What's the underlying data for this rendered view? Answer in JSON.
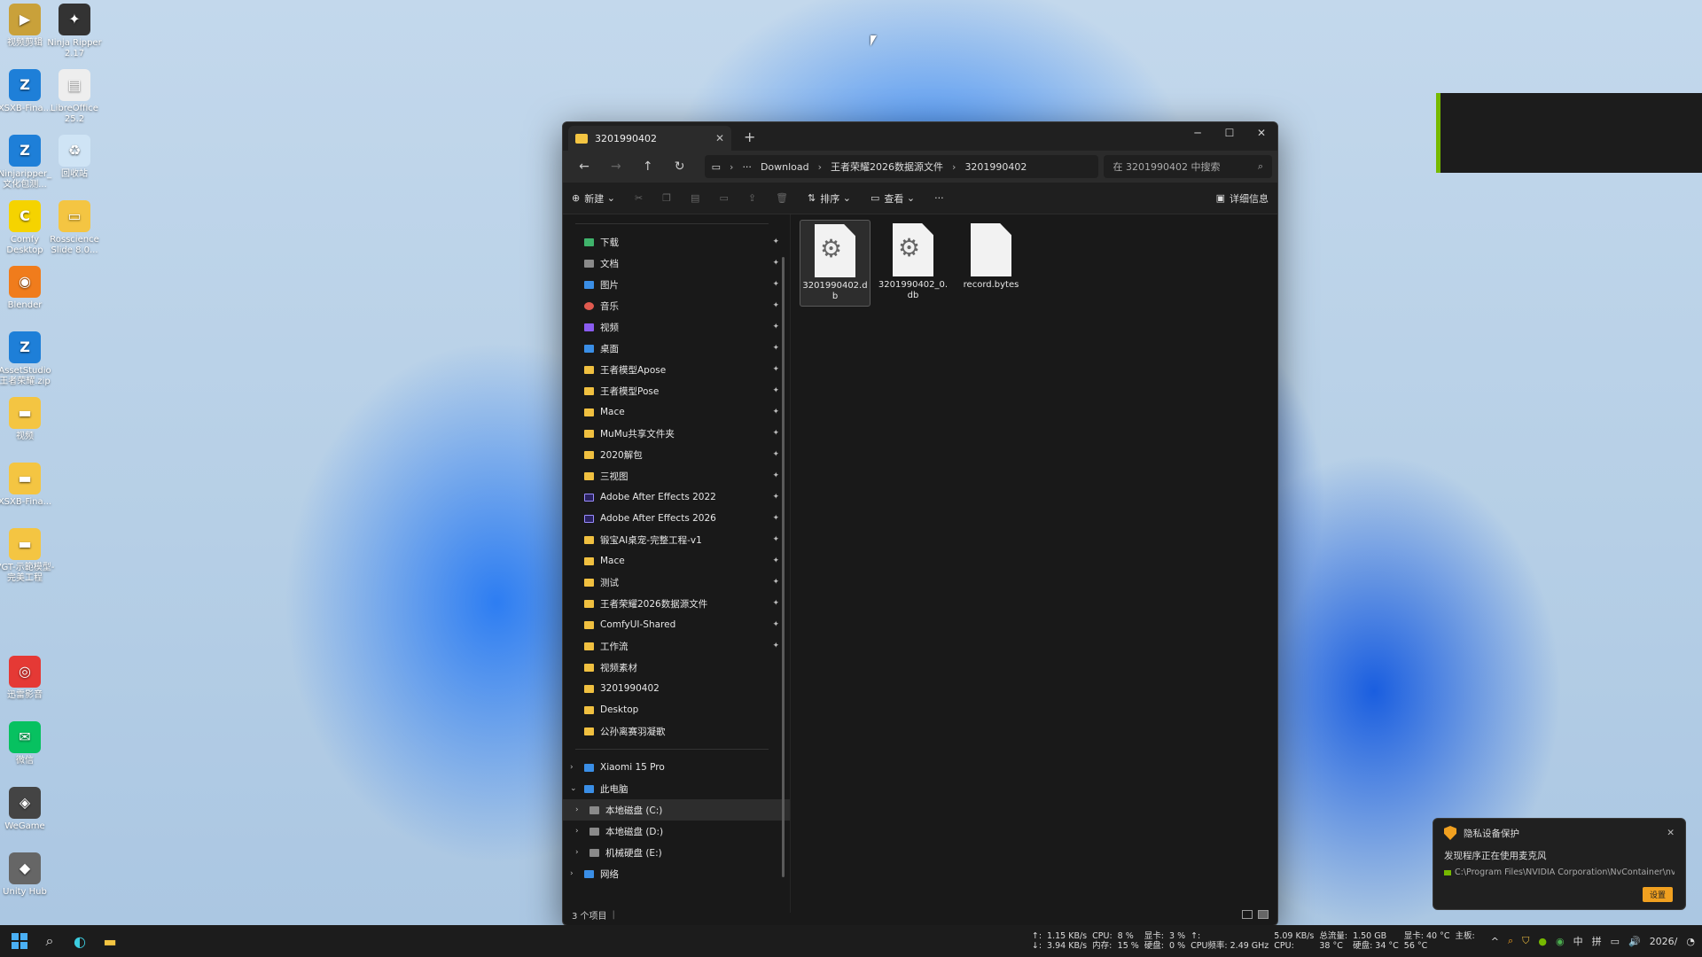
{
  "desktop": {
    "icons": [
      {
        "label": "视频剪辑",
        "glyph": "▶",
        "color": "#c9a13a"
      },
      {
        "label": "Ninja Ripper 2.17",
        "glyph": "✦",
        "color": "#333333"
      },
      {
        "label": "XSXB-Fina...",
        "glyph": "Z",
        "color": "#1e7fd8"
      },
      {
        "label": "LibreOffice 25.2",
        "glyph": "▤",
        "color": "#eeeeee"
      },
      {
        "label": "Ninjaripper_文化包测...",
        "glyph": "Z",
        "color": "#1e7fd8"
      },
      {
        "label": "回收站",
        "glyph": "♻",
        "color": "#cfe4f5"
      },
      {
        "label": "Comfy Desktop",
        "glyph": "C",
        "color": "#f5d300"
      },
      {
        "label": "Rosscience Slide 8.0...",
        "glyph": "▭",
        "color": "#f4c542"
      },
      {
        "label": "Blender",
        "glyph": "◉",
        "color": "#f07c1c"
      },
      {
        "label": "AssetStudio 王者荣耀.zip",
        "glyph": "Z",
        "color": "#1e7fd8"
      },
      {
        "label": "视频",
        "glyph": "▬",
        "color": "#f4c542"
      },
      {
        "label": "XSXB-Fina...",
        "glyph": "▬",
        "color": "#f4c542"
      },
      {
        "label": "VGT-示範模型-完美工程",
        "glyph": "▬",
        "color": "#f4c542"
      },
      {
        "label": "迅雷影音",
        "glyph": "◎",
        "color": "#e53935"
      },
      {
        "label": "微信",
        "glyph": "✉",
        "color": "#07c160"
      },
      {
        "label": "WeGame",
        "glyph": "◈",
        "color": "#444444"
      },
      {
        "label": "Unity Hub",
        "glyph": "◆",
        "color": "#666666"
      }
    ]
  },
  "explorer": {
    "tab_title": "3201990402",
    "tab_close": "✕",
    "new_tab": "+",
    "window_controls": {
      "minimize": "─",
      "maximize": "☐",
      "close": "✕"
    },
    "nav": {
      "back": "←",
      "forward": "→",
      "up": "↑",
      "refresh": "↻",
      "pc": "🖵",
      "more": "···"
    },
    "breadcrumb": [
      "Download",
      "王者荣耀2026数据源文件",
      "3201990402"
    ],
    "search_placeholder": "在 3201990402 中搜索",
    "toolbar": {
      "new": "新建",
      "sort": "排序",
      "view": "查看",
      "more": "···",
      "details": "详细信息"
    },
    "quick_access": [
      {
        "label": "下载",
        "color": "green"
      },
      {
        "label": "文档",
        "color": "gray"
      },
      {
        "label": "图片",
        "color": "blue"
      },
      {
        "label": "音乐",
        "color": "red"
      },
      {
        "label": "视频",
        "color": "purple"
      },
      {
        "label": "桌面",
        "color": "blue"
      },
      {
        "label": "王者模型Apose",
        "color": "folder"
      },
      {
        "label": "王者模型Pose",
        "color": "folder"
      },
      {
        "label": "Mace",
        "color": "folder"
      },
      {
        "label": "MuMu共享文件夹",
        "color": "folder"
      },
      {
        "label": "2020解包",
        "color": "folder"
      },
      {
        "label": "三视图",
        "color": "folder"
      },
      {
        "label": "Adobe After Effects 2022",
        "color": "ae"
      },
      {
        "label": "Adobe After Effects 2026",
        "color": "ae"
      },
      {
        "label": "锻宝AI桌宠-完整工程-v1",
        "color": "folder"
      },
      {
        "label": "Mace",
        "color": "folder"
      },
      {
        "label": "测试",
        "color": "folder"
      },
      {
        "label": "王者荣耀2026数据源文件",
        "color": "folder"
      },
      {
        "label": "ComfyUI-Shared",
        "color": "folder"
      },
      {
        "label": "工作流",
        "color": "folder"
      },
      {
        "label": "视频素材",
        "color": "folder"
      },
      {
        "label": "3201990402",
        "color": "folder"
      },
      {
        "label": "Desktop",
        "color": "folder"
      },
      {
        "label": "公孙离赛羽凝歌",
        "color": "folder"
      }
    ],
    "devices": [
      {
        "label": "Xiaomi 15 Pro",
        "chev": "›",
        "indent": false
      },
      {
        "label": "此电脑",
        "chev": "⌄",
        "indent": false
      },
      {
        "label": "本地磁盘 (C:)",
        "chev": "›",
        "indent": true
      },
      {
        "label": "本地磁盘 (D:)",
        "chev": "›",
        "indent": true
      },
      {
        "label": "机械硬盘 (E:)",
        "chev": "›",
        "indent": true
      },
      {
        "label": "网络",
        "chev": "›",
        "indent": false
      }
    ],
    "files": [
      {
        "name": "3201990402.db",
        "type": "db"
      },
      {
        "name": "3201990402_0.db",
        "type": "db"
      },
      {
        "name": "record.bytes",
        "type": "blank"
      }
    ],
    "status": "3 个项目"
  },
  "notification": {
    "title": "隐私设备保护",
    "message": "发现程序正在使用麦克风",
    "path": "C:\\Program Files\\NVIDIA Corporation\\NvContainer\\nvcon...",
    "button": "设置",
    "close": "✕"
  },
  "taskbar": {
    "stats": {
      "row1": [
        "↑:",
        "1.15 KB/s",
        "CPU:",
        "8 %",
        "显卡:",
        "3 %",
        "↑:",
        "5.09 KB/s",
        "总流量:",
        "1.50 GB",
        "显卡: 40 °C",
        "主板:"
      ],
      "row2": [
        "↓:",
        "3.94 KB/s",
        "内存:",
        "15 %",
        "硬盘:",
        "0 %",
        "CPU频率: 2.49 GHz",
        "CPU:",
        "38 °C",
        "硬盘: 34 °C",
        "56 °C"
      ]
    },
    "tray": [
      "^",
      "中",
      "拼"
    ],
    "date": "2026/"
  }
}
